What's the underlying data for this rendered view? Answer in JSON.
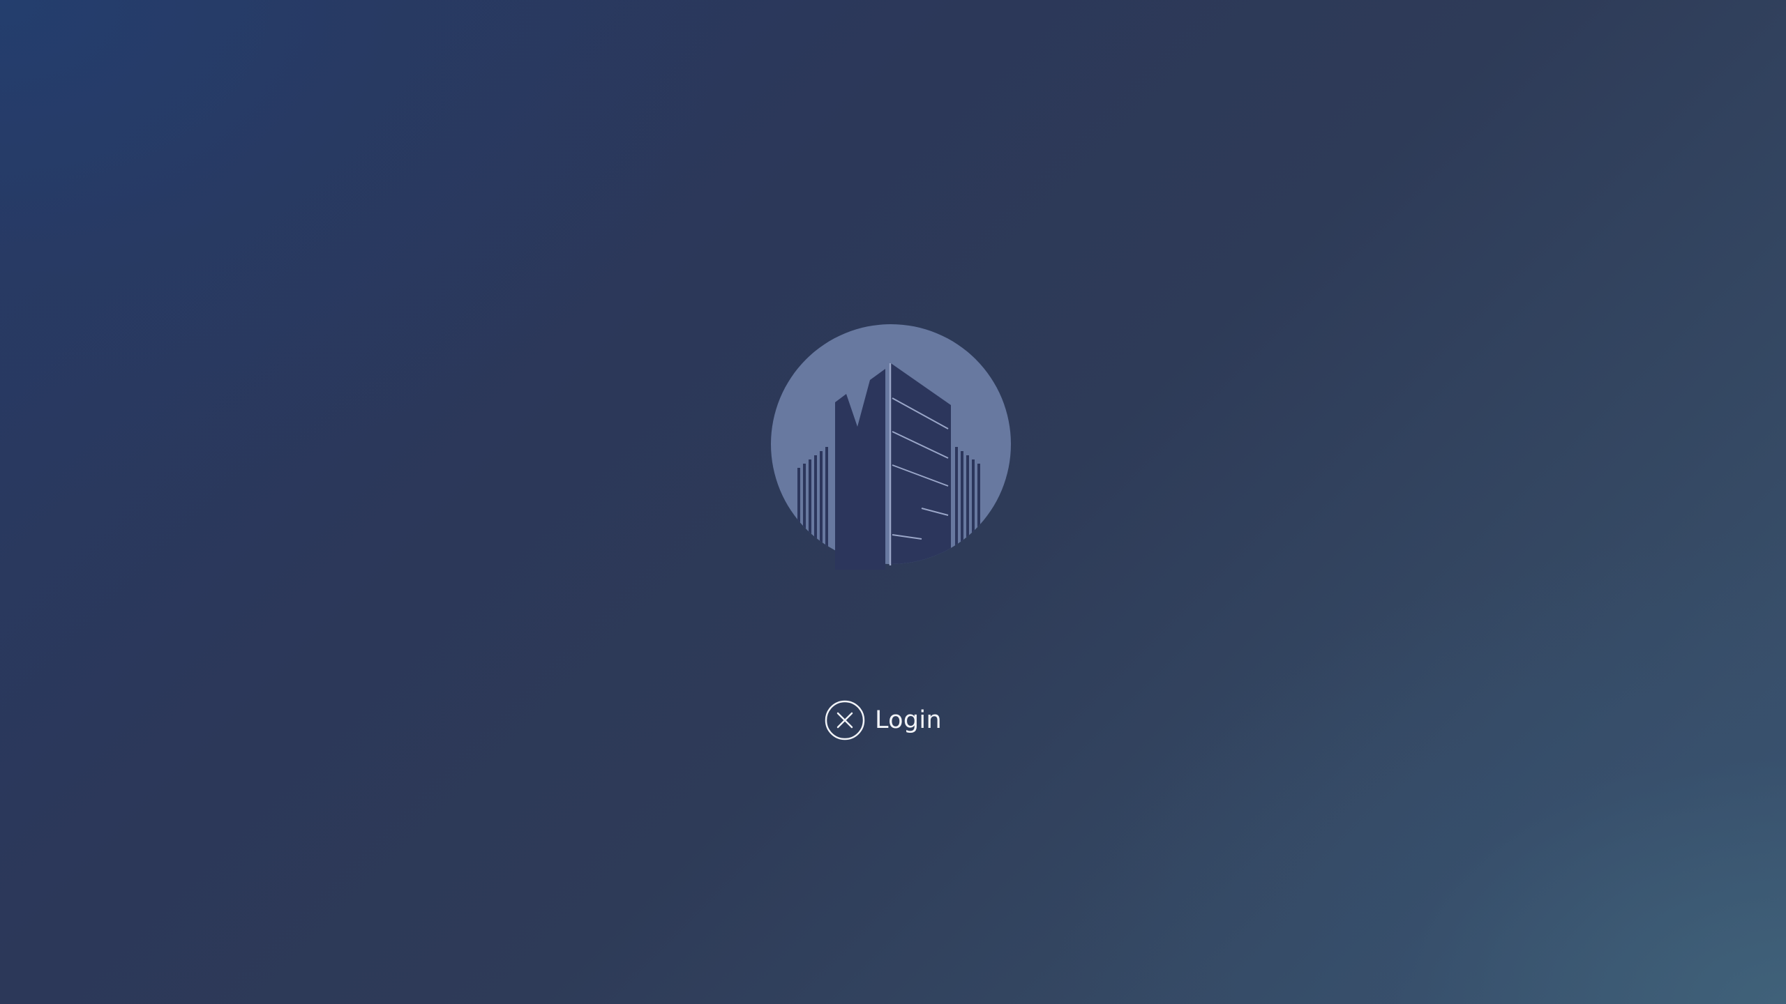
{
  "login": {
    "label": "Login",
    "icon": "close-circle-icon"
  },
  "logo": {
    "icon": "building-logo-icon"
  },
  "colors": {
    "logo_circle": "#6879a0",
    "building": "#2c365c",
    "building_lines": "#9aa6c8",
    "text": "#f2f4f8"
  }
}
